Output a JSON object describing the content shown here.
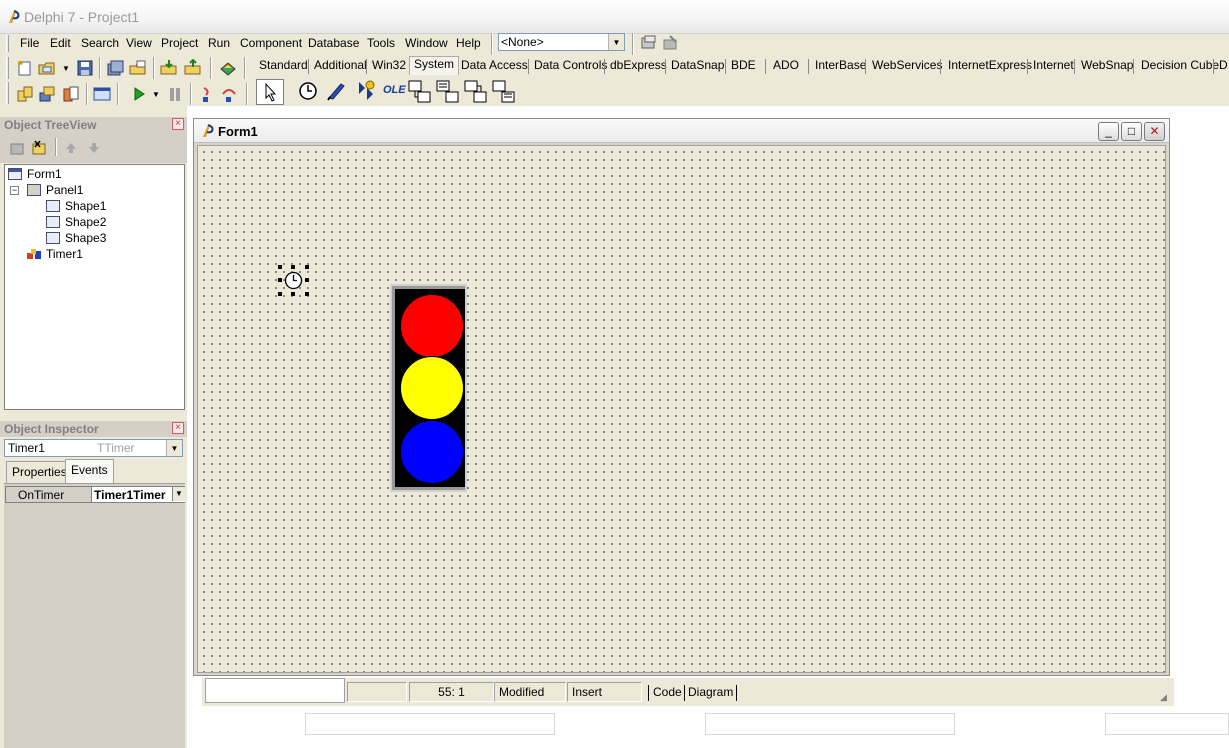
{
  "app": {
    "title": "Delphi 7 - Project1"
  },
  "menu": [
    "File",
    "Edit",
    "Search",
    "View",
    "Project",
    "Run",
    "Component",
    "Database",
    "Tools",
    "Window",
    "Help"
  ],
  "config_combo": {
    "value": "<None>"
  },
  "palette_tabs": [
    "Standard",
    "Additional",
    "Win32",
    "System",
    "Data Access",
    "Data Controls",
    "dbExpress",
    "DataSnap",
    "BDE",
    "ADO",
    "InterBase",
    "WebServices",
    "InternetExpress",
    "Internet",
    "WebSnap",
    "Decision Cube",
    "D"
  ],
  "palette_active": "System",
  "palette_icons": {
    "ole_label": "OLE"
  },
  "tree_view": {
    "title": "Object TreeView",
    "items": [
      {
        "label": "Form1"
      },
      {
        "label": "Panel1"
      },
      {
        "label": "Shape1"
      },
      {
        "label": "Shape2"
      },
      {
        "label": "Shape3"
      },
      {
        "label": "Timer1"
      }
    ]
  },
  "inspector": {
    "title": "Object Inspector",
    "object_name": "Timer1",
    "object_type": "TTimer",
    "tabs": [
      "Properties",
      "Events"
    ],
    "active_tab": "Events",
    "rows": [
      {
        "name": "OnTimer",
        "value": "Timer1Timer"
      }
    ]
  },
  "form": {
    "title": "Form1"
  },
  "lamps": {
    "top": "#ff0000",
    "middle": "#ffff00",
    "bottom": "#0000ff"
  },
  "statusbar": {
    "position": "55:   1",
    "modified": "Modified",
    "mode": "Insert",
    "tab_code": "Code",
    "tab_diagram": "Diagram"
  }
}
